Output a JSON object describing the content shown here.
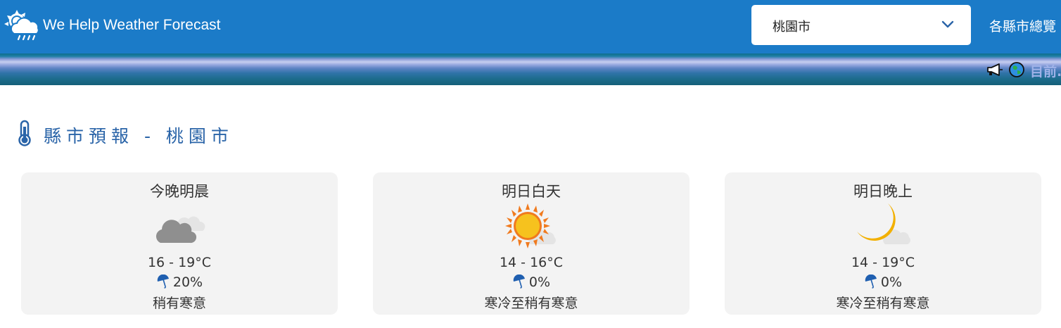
{
  "header": {
    "brand": "We Help Weather Forecast",
    "city_select": {
      "value": "桃園市"
    },
    "overview_link": "各縣市總覽"
  },
  "ticker": {
    "text": "目前..."
  },
  "section": {
    "title": "縣市預報 - 桃園市"
  },
  "forecasts": [
    {
      "period": "今晚明晨",
      "icon": "cloudy-icon",
      "temp": "16 - 19°C",
      "rain": "20%",
      "feel": "稍有寒意"
    },
    {
      "period": "明日白天",
      "icon": "sunny-partly-cloudy-icon",
      "temp": "14 - 16°C",
      "rain": "0%",
      "feel": "寒冷至稍有寒意"
    },
    {
      "period": "明日晚上",
      "icon": "moon-partly-cloudy-icon",
      "temp": "14 - 19°C",
      "rain": "0%",
      "feel": "寒冷至稍有寒意"
    }
  ],
  "colors": {
    "header_bg": "#1b7bc8",
    "title_blue": "#2a64a8",
    "card_bg": "#f3f3f3",
    "sun": "#f6c21e",
    "moon": "#f2b000"
  }
}
